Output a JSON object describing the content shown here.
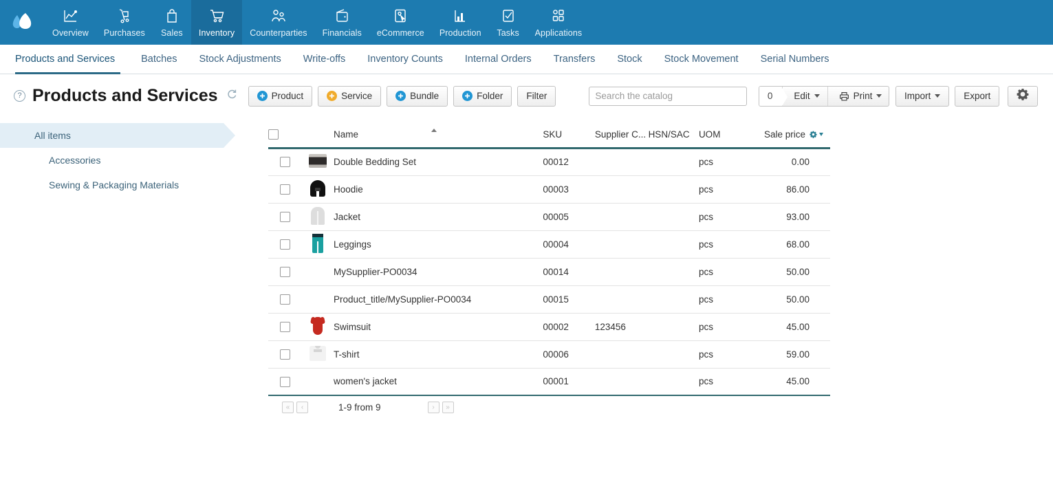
{
  "brand": {
    "logo_name": "mountains-logo",
    "nav_bg": "#1d7bb0",
    "active_bg": "#1a6c9c"
  },
  "topnav": {
    "items": [
      {
        "label": "Overview",
        "icon": "chart-line-icon",
        "active": false
      },
      {
        "label": "Purchases",
        "icon": "hand-truck-icon",
        "active": false
      },
      {
        "label": "Sales",
        "icon": "shopping-bag-icon",
        "active": false
      },
      {
        "label": "Inventory",
        "icon": "shopping-cart-icon",
        "active": true
      },
      {
        "label": "Counterparties",
        "icon": "people-icon",
        "active": false
      },
      {
        "label": "Financials",
        "icon": "wallet-icon",
        "active": false
      },
      {
        "label": "eCommerce",
        "icon": "storefront-cursor-icon",
        "active": false
      },
      {
        "label": "Production",
        "icon": "bar-chart-icon",
        "active": false
      },
      {
        "label": "Tasks",
        "icon": "checkbox-check-icon",
        "active": false
      },
      {
        "label": "Applications",
        "icon": "apps-grid-icon",
        "active": false
      }
    ]
  },
  "subnav": {
    "items": [
      {
        "label": "Products and Services",
        "active": true
      },
      {
        "label": "Batches",
        "active": false
      },
      {
        "label": "Stock Adjustments",
        "active": false
      },
      {
        "label": "Write-offs",
        "active": false
      },
      {
        "label": "Inventory Counts",
        "active": false
      },
      {
        "label": "Internal Orders",
        "active": false
      },
      {
        "label": "Transfers",
        "active": false
      },
      {
        "label": "Stock",
        "active": false
      },
      {
        "label": "Stock Movement",
        "active": false
      },
      {
        "label": "Serial Numbers",
        "active": false
      }
    ]
  },
  "toolbar": {
    "help_label": "?",
    "title": "Products and Services",
    "refresh_icon": "refresh-icon",
    "product_label": "Product",
    "service_label": "Service",
    "bundle_label": "Bundle",
    "folder_label": "Folder",
    "filter_label": "Filter",
    "search_value": "",
    "search_placeholder": "Search the catalog",
    "selection_count": "0",
    "edit_label": "Edit",
    "print_label": "Print",
    "import_label": "Import",
    "export_label": "Export",
    "settings_icon": "gear-icon",
    "accent_blue": "#2196d4",
    "accent_orange": "#f0ab2c"
  },
  "sidebar": {
    "items": [
      {
        "label": "All items",
        "level": 1,
        "selected": true
      },
      {
        "label": "Accessories",
        "level": 2,
        "selected": false
      },
      {
        "label": "Sewing & Packaging Materials",
        "level": 2,
        "selected": false
      }
    ]
  },
  "table": {
    "columns": [
      {
        "key": "check",
        "label": ""
      },
      {
        "key": "thumb",
        "label": ""
      },
      {
        "key": "name",
        "label": "Name",
        "sorted": "asc"
      },
      {
        "key": "sku",
        "label": "SKU"
      },
      {
        "key": "supplier",
        "label": "Supplier C..."
      },
      {
        "key": "hsn",
        "label": "HSN/SAC"
      },
      {
        "key": "uom",
        "label": "UOM"
      },
      {
        "key": "price",
        "label": "Sale price"
      }
    ],
    "rows": [
      {
        "thumb": "bed",
        "name": "Double Bedding Set",
        "sku": "00012",
        "supplier": "",
        "hsn": "",
        "uom": "pcs",
        "price": "0.00"
      },
      {
        "thumb": "hoodie",
        "name": "Hoodie",
        "sku": "00003",
        "supplier": "",
        "hsn": "",
        "uom": "pcs",
        "price": "86.00"
      },
      {
        "thumb": "jacket",
        "name": "Jacket",
        "sku": "00005",
        "supplier": "",
        "hsn": "",
        "uom": "pcs",
        "price": "93.00"
      },
      {
        "thumb": "leggings",
        "name": "Leggings",
        "sku": "00004",
        "supplier": "",
        "hsn": "",
        "uom": "pcs",
        "price": "68.00"
      },
      {
        "thumb": "",
        "name": "MySupplier-PO0034",
        "sku": "00014",
        "supplier": "",
        "hsn": "",
        "uom": "pcs",
        "price": "50.00"
      },
      {
        "thumb": "",
        "name": "Product_title/MySupplier-PO0034",
        "sku": "00015",
        "supplier": "",
        "hsn": "",
        "uom": "pcs",
        "price": "50.00"
      },
      {
        "thumb": "swim",
        "name": "Swimsuit",
        "sku": "00002",
        "supplier": "123456",
        "hsn": "",
        "uom": "pcs",
        "price": "45.00"
      },
      {
        "thumb": "tshirt",
        "name": "T-shirt",
        "sku": "00006",
        "supplier": "",
        "hsn": "",
        "uom": "pcs",
        "price": "59.00"
      },
      {
        "thumb": "",
        "name": "women's jacket",
        "sku": "00001",
        "supplier": "",
        "hsn": "",
        "uom": "pcs",
        "price": "45.00"
      }
    ]
  },
  "pagination": {
    "first_label": "«",
    "prev_label": "‹",
    "range_label": "1-9 from 9",
    "next_label": "›",
    "last_label": "»"
  }
}
